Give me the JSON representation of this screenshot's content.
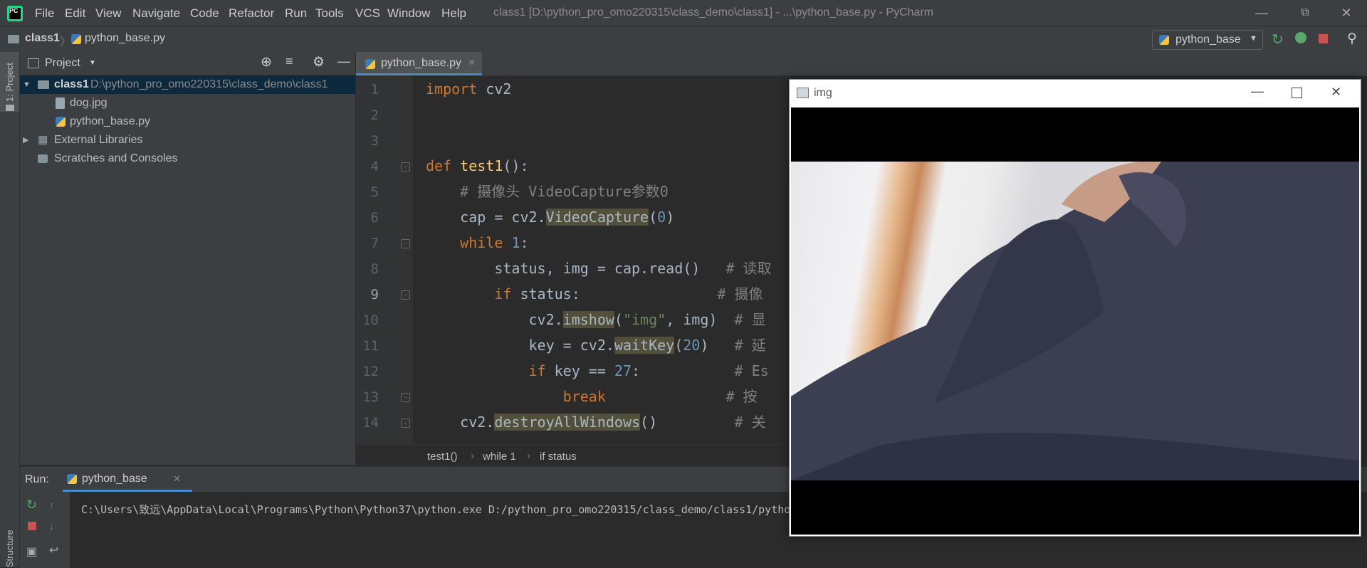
{
  "app": {
    "logo_text": "PC",
    "menu": [
      "File",
      "Edit",
      "View",
      "Navigate",
      "Code",
      "Refactor",
      "Run",
      "Tools",
      "VCS",
      "Window",
      "Help"
    ],
    "window_title": "class1 [D:\\python_pro_omo220315\\class_demo\\class1] - ...\\python_base.py - PyCharm"
  },
  "navbar": {
    "crumbs": [
      "class1",
      "python_base.py"
    ],
    "run_config": "python_base"
  },
  "left_strip": {
    "project_label": "1: Project",
    "structure_label": "Structure"
  },
  "project_panel": {
    "title": "Project",
    "tree": {
      "root_name": "class1",
      "root_path": "D:\\python_pro_omo220315\\class_demo\\class1",
      "files": [
        "dog.jpg",
        "python_base.py"
      ],
      "external": "External Libraries",
      "scratches": "Scratches and Consoles"
    }
  },
  "editor": {
    "tab_label": "python_base.py",
    "line_numbers": [
      "1",
      "2",
      "3",
      "4",
      "5",
      "6",
      "7",
      "8",
      "9",
      "10",
      "11",
      "12",
      "13",
      "14"
    ],
    "current_line": "9",
    "breadcrumbs": [
      "test1()",
      "while 1",
      "if status"
    ]
  },
  "code": {
    "l1_kw": "import",
    "l1_rest": " cv2",
    "l4_kw": "def",
    "l4_fn": "test1",
    "l4_rest": "():",
    "l5_cm": "# 摄像头 VideoCapture参数0",
    "l6_a": "cap = cv2.",
    "l6_fn": "VideoCapture",
    "l6_b": "(",
    "l6_num": "0",
    "l6_c": ")",
    "l7_kw": "while",
    "l7_num": "1",
    "l7_rest": ":",
    "l8_code": "status, img = cap.read()   ",
    "l8_cm": "# 读取",
    "l9_kw": "if",
    "l9_code": " status:                ",
    "l9_cm": "# 摄像",
    "l10_a": "cv2.",
    "l10_fn": "imshow",
    "l10_b": "(",
    "l10_str": "\"img\"",
    "l10_c": ", img)  ",
    "l10_cm": "# 显",
    "l11_a": "key = cv2.",
    "l11_fn": "waitKey",
    "l11_b": "(",
    "l11_num": "20",
    "l11_c": ")   ",
    "l11_cm": "# 延",
    "l12_kw": "if",
    "l12_a": " key == ",
    "l12_num": "27",
    "l12_b": ":           ",
    "l12_cm": "# Es",
    "l13_kw": "break",
    "l13_pad": "              ",
    "l13_cm": "# 按",
    "l14_a": "cv2.",
    "l14_fn": "destroyAllWindows",
    "l14_b": "()         ",
    "l14_cm": "# 关"
  },
  "run_panel": {
    "label": "Run:",
    "tab": "python_base",
    "output": "C:\\Users\\致远\\AppData\\Local\\Programs\\Python\\Python37\\python.exe D:/python_pro_omo220315/class_demo/class1/pytho"
  },
  "img_window": {
    "title": "img"
  },
  "colors": {
    "accent": "#4a88c7",
    "keyword": "#cc7832",
    "function": "#ffc66d",
    "number": "#6897bb",
    "string": "#6a8759",
    "comment": "#808080"
  }
}
